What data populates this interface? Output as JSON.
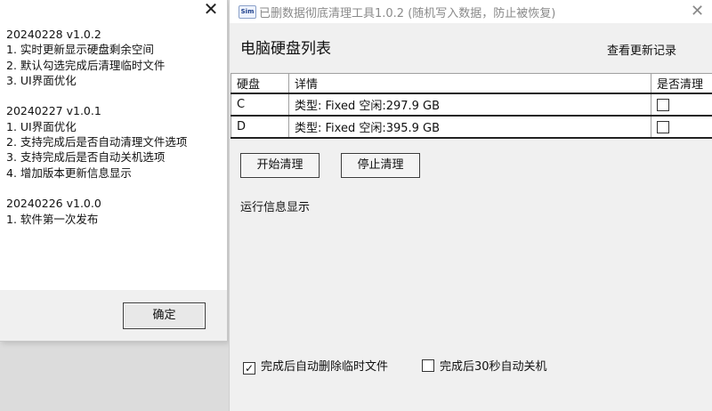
{
  "changelog_dialog": {
    "close_glyph": "✕",
    "log_lines": [
      "20240228 v1.0.2",
      "1. 实时更新显示硬盘剩余空间",
      "2. 默认勾选完成后清理临时文件",
      "3. UI界面优化",
      "",
      "20240227 v1.0.1",
      "1. UI界面优化",
      "2. 支持完成后是否自动清理文件选项",
      "3. 支持完成后是否自动关机选项",
      "4. 增加版本更新信息显示",
      "",
      "20240226 v1.0.0",
      "1. 软件第一次发布"
    ],
    "ok_label": "确定"
  },
  "main_window": {
    "app_icon_text": "Sim",
    "title": "已删数据彻底清理工具1.0.2 (随机写入数据，防止被恢复)",
    "close_glyph": "✕",
    "heading": "电脑硬盘列表",
    "changelog_link": "查看更新记录",
    "table": {
      "headers": [
        "硬盘",
        "详情",
        "是否清理"
      ],
      "rows": [
        {
          "disk": "C",
          "detail": "类型: Fixed 空闲:297.9 GB",
          "checked": false
        },
        {
          "disk": "D",
          "detail": "类型: Fixed 空闲:395.9 GB",
          "checked": false
        }
      ]
    },
    "start_button": "开始清理",
    "stop_button": "停止清理",
    "run_info_label": "运行信息显示",
    "options": [
      {
        "label": "完成后自动删除临时文件",
        "checked": true
      },
      {
        "label": "完成后30秒自动关机",
        "checked": false
      }
    ]
  }
}
